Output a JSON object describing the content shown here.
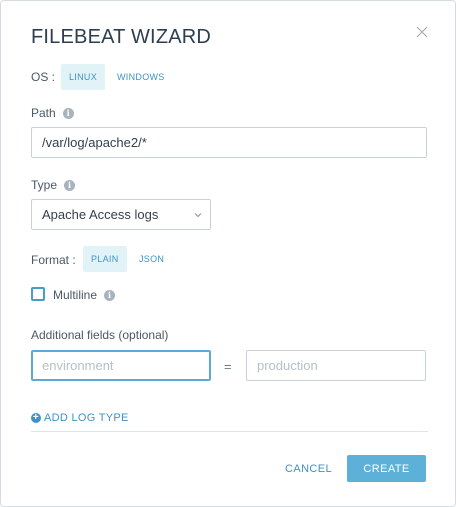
{
  "dialog": {
    "title": "FILEBEAT WIZARD",
    "close_icon": "close-icon"
  },
  "os": {
    "label": "OS :",
    "options": [
      "LINUX",
      "WINDOWS"
    ],
    "selected": "LINUX"
  },
  "path": {
    "label": "Path",
    "value": "/var/log/apache2/*",
    "info_icon": "info-icon"
  },
  "type": {
    "label": "Type",
    "selected": "Apache Access logs",
    "info_icon": "info-icon"
  },
  "format": {
    "label": "Format :",
    "options": [
      "PLAIN",
      "JSON"
    ],
    "selected": "PLAIN"
  },
  "multiline": {
    "label": "Multiline",
    "checked": false,
    "info_icon": "info-icon"
  },
  "additional_fields": {
    "label": "Additional fields (optional)",
    "key_placeholder": "environment",
    "equals": "=",
    "value_placeholder": "production"
  },
  "actions": {
    "add_log_type": "ADD LOG TYPE",
    "cancel": "CANCEL",
    "create": "CREATE"
  },
  "colors": {
    "accent": "#3f93c3",
    "primary_button": "#5db1d9",
    "active_toggle_bg": "#e2f3f8"
  }
}
